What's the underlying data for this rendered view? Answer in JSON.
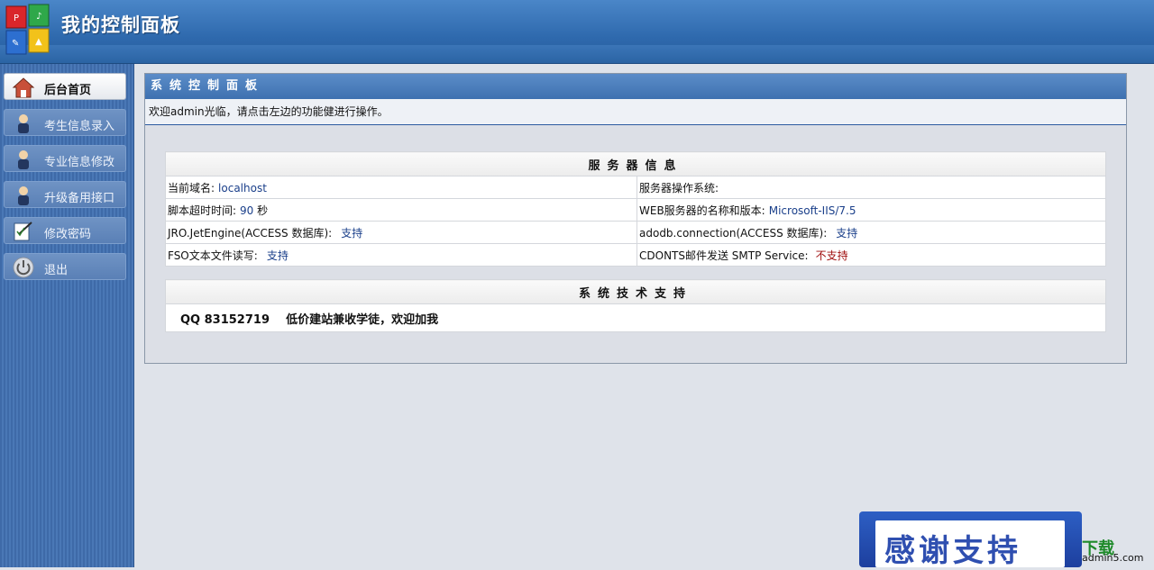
{
  "app": {
    "title": "我的控制面板"
  },
  "sidebar": {
    "items": [
      {
        "label": "后台首页",
        "icon": "house-icon",
        "active": true
      },
      {
        "label": "考生信息录入",
        "icon": "person-icon"
      },
      {
        "label": "专业信息修改",
        "icon": "person-icon"
      },
      {
        "label": "升级备用接口",
        "icon": "person-icon"
      },
      {
        "label": "修改密码",
        "icon": "pen-icon"
      },
      {
        "label": "退出",
        "icon": "power-icon"
      }
    ]
  },
  "panel": {
    "title": "系统控制面板",
    "welcome": "欢迎admin光临，请点击左边的功能健进行操作。"
  },
  "server_info": {
    "heading": "服务器信息",
    "rows": [
      {
        "l_label": "当前域名:",
        "l_value": "localhost",
        "r_label": "服务器操作系统:",
        "r_value": ""
      },
      {
        "l_label": "脚本超时时间:",
        "l_value": "90",
        "l_suffix": "秒",
        "r_label": "WEB服务器的名称和版本:",
        "r_value": "Microsoft-IIS/7.5"
      },
      {
        "l_label": "JRO.JetEngine(ACCESS 数据库):",
        "l_value": "支持",
        "r_label": "adodb.connection(ACCESS 数据库):",
        "r_value": "支持"
      },
      {
        "l_label": "FSO文本文件读写:",
        "l_value": "支持",
        "r_label": "CDONTS邮件发送  SMTP Service:",
        "r_value": "不支持"
      }
    ]
  },
  "support": {
    "heading": "系统技术支持",
    "text": "QQ 83152719    低价建站兼收学徒，欢迎加我"
  },
  "watermark": {
    "main": "感谢支持",
    "side": "下载",
    "site": "admin5.com"
  }
}
